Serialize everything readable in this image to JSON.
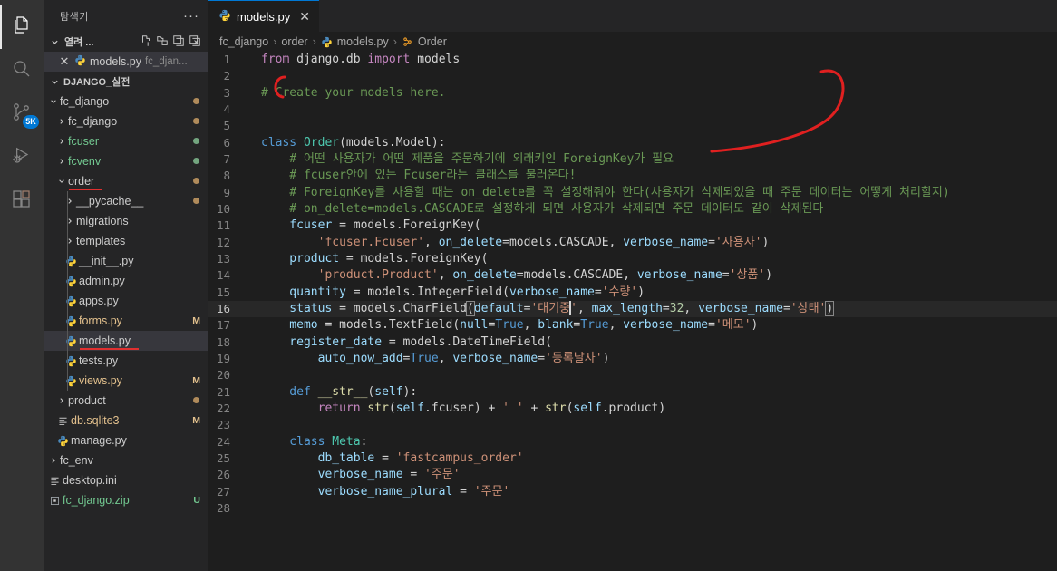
{
  "activitybar": {
    "items": [
      {
        "name": "explorer",
        "icon": "files-icon",
        "active": true,
        "badge": null
      },
      {
        "name": "search",
        "icon": "search-icon",
        "active": false,
        "badge": null
      },
      {
        "name": "source-control",
        "icon": "source-control-icon",
        "active": false,
        "badge": "5K"
      },
      {
        "name": "run-debug",
        "icon": "run-and-debug-icon",
        "active": false,
        "badge": null
      },
      {
        "name": "extensions",
        "icon": "extensions-icon",
        "active": false,
        "badge": null
      }
    ]
  },
  "sidebar": {
    "title": "탐색기",
    "more_actions": "···",
    "open_editors": {
      "label": "열려 ...",
      "actions": [
        "new-file-icon",
        "new-folder-icon",
        "save-all-icon",
        "close-all-icon"
      ],
      "items": [
        {
          "name": "models.py",
          "path": "fc_djan...",
          "icon": "python-icon",
          "selected": true
        }
      ]
    },
    "project": {
      "label": "DJANGO_실전",
      "tree": [
        {
          "label": "fc_django",
          "depth": 1,
          "type": "folder",
          "expanded": true,
          "dot": "#b08b5b",
          "color": "normal"
        },
        {
          "label": "fc_django",
          "depth": 2,
          "type": "folder",
          "expanded": false,
          "dot": "#b08b5b",
          "color": "normal"
        },
        {
          "label": "fcuser",
          "depth": 2,
          "type": "folder",
          "expanded": false,
          "dot": "#73a57f",
          "color": "green"
        },
        {
          "label": "fcvenv",
          "depth": 2,
          "type": "folder",
          "expanded": false,
          "dot": "#73a57f",
          "color": "green"
        },
        {
          "label": "order",
          "depth": 2,
          "type": "folder",
          "expanded": true,
          "dot": "#b08b5b",
          "color": "normal",
          "underline": true
        },
        {
          "label": "__pycache__",
          "depth": 3,
          "type": "folder",
          "expanded": false,
          "dot": "#b08b5b",
          "color": "normal"
        },
        {
          "label": "migrations",
          "depth": 3,
          "type": "folder",
          "expanded": false,
          "dot": null,
          "color": "normal"
        },
        {
          "label": "templates",
          "depth": 3,
          "type": "folder",
          "expanded": false,
          "dot": null,
          "color": "normal"
        },
        {
          "label": "__init__.py",
          "depth": 3,
          "type": "python",
          "status": "",
          "color": "normal"
        },
        {
          "label": "admin.py",
          "depth": 3,
          "type": "python",
          "status": "",
          "color": "normal"
        },
        {
          "label": "apps.py",
          "depth": 3,
          "type": "python",
          "status": "",
          "color": "normal"
        },
        {
          "label": "forms.py",
          "depth": 3,
          "type": "python",
          "status": "M",
          "color": "modified"
        },
        {
          "label": "models.py",
          "depth": 3,
          "type": "python",
          "status": "",
          "color": "normal",
          "selected": true,
          "underline": true
        },
        {
          "label": "tests.py",
          "depth": 3,
          "type": "python",
          "status": "",
          "color": "normal"
        },
        {
          "label": "views.py",
          "depth": 3,
          "type": "python",
          "status": "M",
          "color": "modified"
        },
        {
          "label": "product",
          "depth": 2,
          "type": "folder",
          "expanded": false,
          "dot": "#b08b5b",
          "color": "normal"
        },
        {
          "label": "db.sqlite3",
          "depth": 2,
          "type": "db",
          "status": "M",
          "color": "modified"
        },
        {
          "label": "manage.py",
          "depth": 2,
          "type": "python",
          "status": "",
          "color": "normal"
        },
        {
          "label": "fc_env",
          "depth": 1,
          "type": "folder",
          "expanded": false,
          "dot": null,
          "color": "normal"
        },
        {
          "label": "desktop.ini",
          "depth": 1,
          "type": "ini",
          "status": "",
          "color": "normal"
        },
        {
          "label": "fc_django.zip",
          "depth": 1,
          "type": "zip",
          "status": "U",
          "color": "green"
        }
      ]
    }
  },
  "editor": {
    "tab": {
      "label": "models.py",
      "icon": "python-icon",
      "close": "✕"
    },
    "breadcrumb": [
      "fc_django",
      "order",
      "models.py",
      "Order"
    ],
    "breadcrumb_sep": "›",
    "active_line": 16,
    "lines": [
      {
        "n": 1,
        "tokens": [
          {
            "t": "from ",
            "c": "kw"
          },
          {
            "t": "django.db ",
            "c": "pln"
          },
          {
            "t": "import ",
            "c": "kw"
          },
          {
            "t": "models",
            "c": "pln"
          }
        ]
      },
      {
        "n": 2,
        "tokens": []
      },
      {
        "n": 3,
        "tokens": [
          {
            "t": "# Create your models here.",
            "c": "com"
          }
        ]
      },
      {
        "n": 4,
        "tokens": []
      },
      {
        "n": 5,
        "tokens": []
      },
      {
        "n": 6,
        "tokens": [
          {
            "t": "class ",
            "c": "kw2"
          },
          {
            "t": "Order",
            "c": "cls"
          },
          {
            "t": "(models.Model):",
            "c": "pln"
          }
        ]
      },
      {
        "n": 7,
        "tokens": [
          {
            "t": "    # 어떤 사용자가 어떤 제품을 주문하기에 외래키인 ForeignKey가 필요",
            "c": "com"
          }
        ]
      },
      {
        "n": 8,
        "tokens": [
          {
            "t": "    # fcuser안에 있는 Fcuser라는 클래스를 불러온다!",
            "c": "com"
          }
        ]
      },
      {
        "n": 9,
        "tokens": [
          {
            "t": "    # ForeignKey를 사용할 때는 on_delete를 꼭 설정해줘야 한다(사용자가 삭제되었을 때 주문 데이터는 어떻게 처리할지)",
            "c": "com"
          }
        ]
      },
      {
        "n": 10,
        "tokens": [
          {
            "t": "    # on_delete=models.CASCADE로 설정하게 되면 사용자가 삭제되면 주문 데이터도 같이 삭제된다",
            "c": "com"
          }
        ]
      },
      {
        "n": 11,
        "tokens": [
          {
            "t": "    fcuser ",
            "c": "var"
          },
          {
            "t": "= models.ForeignKey(",
            "c": "pln"
          }
        ]
      },
      {
        "n": 12,
        "tokens": [
          {
            "t": "        ",
            "c": "pln"
          },
          {
            "t": "'fcuser.Fcuser'",
            "c": "str"
          },
          {
            "t": ", ",
            "c": "pln"
          },
          {
            "t": "on_delete",
            "c": "var"
          },
          {
            "t": "=models.CASCADE, ",
            "c": "pln"
          },
          {
            "t": "verbose_name",
            "c": "var"
          },
          {
            "t": "=",
            "c": "pln"
          },
          {
            "t": "'사용자'",
            "c": "str"
          },
          {
            "t": ")",
            "c": "pln"
          }
        ]
      },
      {
        "n": 13,
        "tokens": [
          {
            "t": "    product ",
            "c": "var"
          },
          {
            "t": "= models.ForeignKey(",
            "c": "pln"
          }
        ]
      },
      {
        "n": 14,
        "tokens": [
          {
            "t": "        ",
            "c": "pln"
          },
          {
            "t": "'product.Product'",
            "c": "str"
          },
          {
            "t": ", ",
            "c": "pln"
          },
          {
            "t": "on_delete",
            "c": "var"
          },
          {
            "t": "=models.CASCADE, ",
            "c": "pln"
          },
          {
            "t": "verbose_name",
            "c": "var"
          },
          {
            "t": "=",
            "c": "pln"
          },
          {
            "t": "'상품'",
            "c": "str"
          },
          {
            "t": ")",
            "c": "pln"
          }
        ]
      },
      {
        "n": 15,
        "tokens": [
          {
            "t": "    quantity ",
            "c": "var"
          },
          {
            "t": "= models.IntegerField(",
            "c": "pln"
          },
          {
            "t": "verbose_name",
            "c": "var"
          },
          {
            "t": "=",
            "c": "pln"
          },
          {
            "t": "'수량'",
            "c": "str"
          },
          {
            "t": ")",
            "c": "pln"
          }
        ]
      },
      {
        "n": 16,
        "tokens": [
          {
            "t": "    status ",
            "c": "var"
          },
          {
            "t": "= models.CharField",
            "c": "pln"
          },
          {
            "t": "(",
            "c": "brk"
          },
          {
            "t": "default",
            "c": "var"
          },
          {
            "t": "=",
            "c": "pln"
          },
          {
            "t": "'대기중",
            "c": "str"
          },
          {
            "t": "|CURSOR|",
            "c": "cur"
          },
          {
            "t": "'",
            "c": "str"
          },
          {
            "t": ", ",
            "c": "pln"
          },
          {
            "t": "max_length",
            "c": "var"
          },
          {
            "t": "=",
            "c": "pln"
          },
          {
            "t": "32",
            "c": "num"
          },
          {
            "t": ", ",
            "c": "pln"
          },
          {
            "t": "verbose_name",
            "c": "var"
          },
          {
            "t": "=",
            "c": "pln"
          },
          {
            "t": "'상태'",
            "c": "str"
          },
          {
            "t": ")",
            "c": "brk"
          }
        ]
      },
      {
        "n": 17,
        "tokens": [
          {
            "t": "    memo ",
            "c": "var"
          },
          {
            "t": "= models.TextField(",
            "c": "pln"
          },
          {
            "t": "null",
            "c": "var"
          },
          {
            "t": "=",
            "c": "pln"
          },
          {
            "t": "True",
            "c": "kw2"
          },
          {
            "t": ", ",
            "c": "pln"
          },
          {
            "t": "blank",
            "c": "var"
          },
          {
            "t": "=",
            "c": "pln"
          },
          {
            "t": "True",
            "c": "kw2"
          },
          {
            "t": ", ",
            "c": "pln"
          },
          {
            "t": "verbose_name",
            "c": "var"
          },
          {
            "t": "=",
            "c": "pln"
          },
          {
            "t": "'메모'",
            "c": "str"
          },
          {
            "t": ")",
            "c": "pln"
          }
        ]
      },
      {
        "n": 18,
        "tokens": [
          {
            "t": "    register_date ",
            "c": "var"
          },
          {
            "t": "= models.DateTimeField(",
            "c": "pln"
          }
        ]
      },
      {
        "n": 19,
        "tokens": [
          {
            "t": "        ",
            "c": "pln"
          },
          {
            "t": "auto_now_add",
            "c": "var"
          },
          {
            "t": "=",
            "c": "pln"
          },
          {
            "t": "True",
            "c": "kw2"
          },
          {
            "t": ", ",
            "c": "pln"
          },
          {
            "t": "verbose_name",
            "c": "var"
          },
          {
            "t": "=",
            "c": "pln"
          },
          {
            "t": "'등록날자'",
            "c": "str"
          },
          {
            "t": ")",
            "c": "pln"
          }
        ]
      },
      {
        "n": 20,
        "tokens": []
      },
      {
        "n": 21,
        "tokens": [
          {
            "t": "    def ",
            "c": "kw2"
          },
          {
            "t": "__str__",
            "c": "fn"
          },
          {
            "t": "(",
            "c": "pln"
          },
          {
            "t": "self",
            "c": "var"
          },
          {
            "t": "):",
            "c": "pln"
          }
        ]
      },
      {
        "n": 22,
        "tokens": [
          {
            "t": "        ",
            "c": "pln"
          },
          {
            "t": "return ",
            "c": "kw"
          },
          {
            "t": "str",
            "c": "fn"
          },
          {
            "t": "(",
            "c": "pln"
          },
          {
            "t": "self",
            "c": "var"
          },
          {
            "t": ".fcuser) + ",
            "c": "pln"
          },
          {
            "t": "' '",
            "c": "str"
          },
          {
            "t": " + ",
            "c": "pln"
          },
          {
            "t": "str",
            "c": "fn"
          },
          {
            "t": "(",
            "c": "pln"
          },
          {
            "t": "self",
            "c": "var"
          },
          {
            "t": ".product)",
            "c": "pln"
          }
        ]
      },
      {
        "n": 23,
        "tokens": []
      },
      {
        "n": 24,
        "tokens": [
          {
            "t": "    class ",
            "c": "kw2"
          },
          {
            "t": "Meta",
            "c": "cls"
          },
          {
            "t": ":",
            "c": "pln"
          }
        ]
      },
      {
        "n": 25,
        "tokens": [
          {
            "t": "        db_table ",
            "c": "var"
          },
          {
            "t": "= ",
            "c": "pln"
          },
          {
            "t": "'fastcampus_order'",
            "c": "str"
          }
        ]
      },
      {
        "n": 26,
        "tokens": [
          {
            "t": "        verbose_name ",
            "c": "var"
          },
          {
            "t": "= ",
            "c": "pln"
          },
          {
            "t": "'주문'",
            "c": "str"
          }
        ]
      },
      {
        "n": 27,
        "tokens": [
          {
            "t": "        verbose_name_plural ",
            "c": "var"
          },
          {
            "t": "= ",
            "c": "pln"
          },
          {
            "t": "'주문'",
            "c": "str"
          }
        ]
      },
      {
        "n": 28,
        "tokens": []
      }
    ]
  },
  "colors": {
    "activitybar_bg": "#333333",
    "sidebar_bg": "#252526",
    "editor_bg": "#1e1e1e",
    "accent": "#0078d4",
    "annotation_red": "#e02020",
    "modified_green": "#587c0c"
  }
}
